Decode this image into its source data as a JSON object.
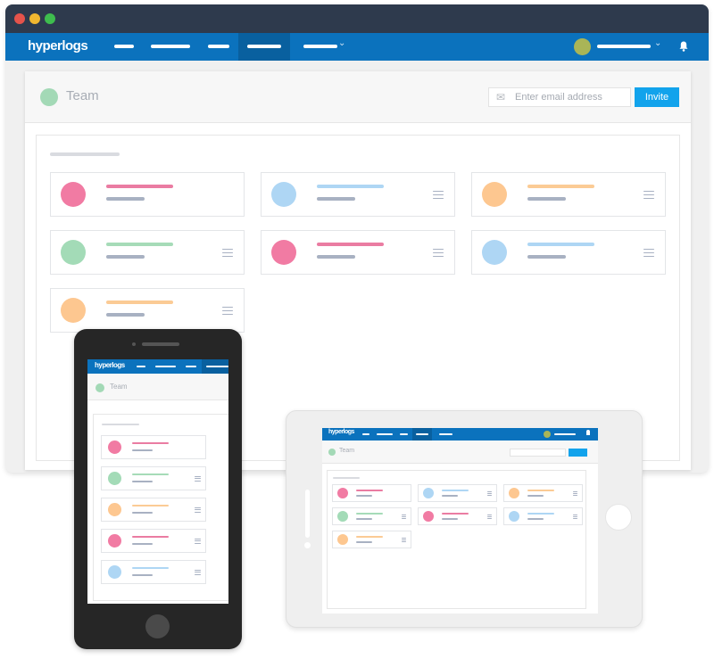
{
  "app": {
    "logo": "hyperlogs",
    "window_controls": [
      {
        "name": "close",
        "color": "#e5534b"
      },
      {
        "name": "minimize",
        "color": "#f1b730"
      },
      {
        "name": "maximize",
        "color": "#3ebd4e"
      }
    ],
    "nav_items": [
      {
        "name": "nav-item-1",
        "active": false
      },
      {
        "name": "nav-item-2",
        "active": false
      },
      {
        "name": "nav-item-3",
        "active": false
      },
      {
        "name": "nav-item-4",
        "active": true
      },
      {
        "name": "nav-item-5-dropdown",
        "active": false,
        "has_caret": true
      }
    ],
    "user_menu": {
      "has_caret": true,
      "avatar_color": "#a9b557"
    },
    "caret_glyph": "⌄",
    "bell_glyph": "🔔",
    "colors": {
      "titlebar": "#2e3a4d",
      "navbar": "#0b72bd",
      "nav_active": "#09609f",
      "invite": "#12a3ec"
    }
  },
  "page": {
    "title": "Team",
    "email_placeholder": "Enter email address",
    "invite_label": "Invite",
    "mail_icon": "✉",
    "menu_icon": "≡"
  },
  "members": [
    {
      "color": "#f17ba3",
      "line_color": "#ea7ca2",
      "has_menu": false
    },
    {
      "color": "#aed6f4",
      "line_color": "#aed6f4",
      "has_menu": true
    },
    {
      "color": "#fdc790",
      "line_color": "#fbcb95",
      "has_menu": true
    },
    {
      "color": "#a3dbb7",
      "line_color": "#a6dbb8",
      "has_menu": true
    },
    {
      "color": "#f17ba3",
      "line_color": "#ea7ca2",
      "has_menu": true
    },
    {
      "color": "#aed6f4",
      "line_color": "#aed6f4",
      "has_menu": true
    },
    {
      "color": "#fdc790",
      "line_color": "#fbcb95",
      "has_menu": true
    }
  ],
  "phone_members": [
    {
      "color": "#f17ba3",
      "line_color": "#ea7ca2",
      "has_menu": false
    },
    {
      "color": "#a3dbb7",
      "line_color": "#a6dbb8",
      "has_menu": true
    },
    {
      "color": "#fdc790",
      "line_color": "#fbcb95",
      "has_menu": true
    },
    {
      "color": "#f17ba3",
      "line_color": "#ea7ca2",
      "has_menu": true
    },
    {
      "color": "#aed6f4",
      "line_color": "#aed6f4",
      "has_menu": true
    }
  ]
}
